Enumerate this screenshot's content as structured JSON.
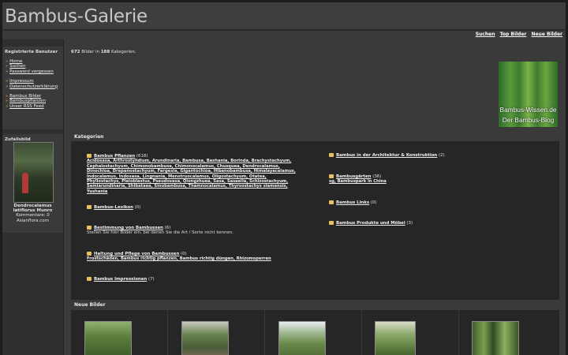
{
  "site": {
    "title": "Bambus-Galerie"
  },
  "topnav": [
    "Suchen",
    "Top Bilder",
    "Neue Bilder"
  ],
  "sidebar": {
    "registered_title": "Registrierte Benutzer",
    "links_a": [
      "Home",
      "Suchen",
      "Password vergessen"
    ],
    "links_b": [
      "Impressum",
      "Datenschutzerklärung"
    ],
    "links_c": [
      "Bambus Bilder",
      "Bambuspflanzen",
      "Unser RSS Feed"
    ],
    "random_title": "Zufallsbild",
    "random_name": "Dendrocalamus latiflorus Munro",
    "random_comments": "Kommentare: 0",
    "random_source": "Asianflora.com"
  },
  "summary": {
    "images": "672",
    "text1": "Bilder in",
    "categories": "188",
    "text2": "Kategorien."
  },
  "banner": {
    "line1": "Bambus-Wissen.de",
    "line2": "Der Bambus-Blog"
  },
  "categories_title": "Kategorien",
  "categories_left": [
    {
      "title": "Bambus Pflanzen",
      "count": "(618)",
      "sub": "Acidosasa, Arthrostylidium, Arundinaria, Bambusa, Bashania, Borinda, Brachystachyum, Cephalostachyum, Chimonobambusa, Chimonocalamus, Chusquea, Dendrocalamus, Dinochloa, Drepanostachyum, Fargesia, Gigantochloa, Hibanobambusa, Himalayacalamus, Indocalamus, Indosasa, Lingnania, Menstruocalamus, Oligostachyum, Otatea, Phyllostachys, Pleioblastus, Pseudosasa, Qiongzhuea, Sasa, Sasaella, Schizostachyum, Semiarundinaria, Shibataea, Sinobambusa, Thamnocalamus, Thyrsostachys siamensis, Yushania",
      "desc": ""
    },
    {
      "title": "Bambus-Lexikon",
      "count": "(0)",
      "sub": "",
      "desc": ""
    },
    {
      "title": "Bestimmung von Bambussen",
      "count": "(6)",
      "sub": "",
      "desc": "Stellen Sie hier Bilder ein, bei denen Sie die Art / Sorte nicht kennen."
    },
    {
      "title": "Haltung und Pflege von Bambussen",
      "count": "(0)",
      "sub": "Frostschäden, Bambus richtig pflanzen, Bambus richtig düngen, Rhizomsperren",
      "desc": ""
    },
    {
      "title": "Bambus Impressionen",
      "count": "(7)",
      "sub": "",
      "desc": ""
    }
  ],
  "categories_right": [
    {
      "title": "Bambus in der Architektur & Konstruktion",
      "count": "(2)",
      "sub": ""
    },
    {
      "title": "Bambusgärten",
      "count": "(36)",
      "sub": "sg, Bambuspark in China"
    },
    {
      "title": "Bambus Links",
      "count": "(0)",
      "sub": ""
    },
    {
      "title": "Bambus Produkte und Möbel",
      "count": "(3)",
      "sub": ""
    }
  ],
  "new_images_title": "Neue Bilder",
  "colors": {
    "background": "#1c1c1c",
    "panel": "#262626",
    "frame": "#3a3a3a",
    "folder": "#e8c060",
    "bullet": "#e8a33c"
  }
}
